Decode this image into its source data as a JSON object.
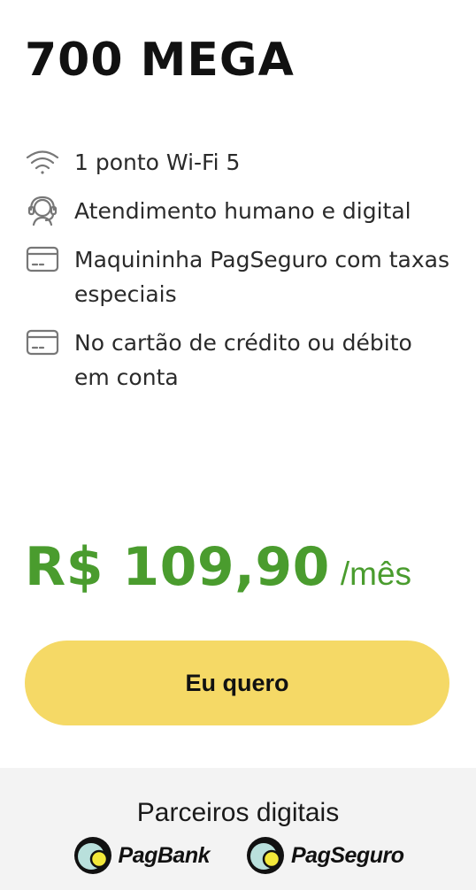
{
  "plan": {
    "title": "700 MEGA"
  },
  "features": [
    {
      "icon": "wifi-icon",
      "text": "1 ponto Wi-Fi 5"
    },
    {
      "icon": "headset-icon",
      "text": "Atendimento humano e digital"
    },
    {
      "icon": "card-terminal-icon",
      "text": "Maquininha PagSeguro com taxas especiais"
    },
    {
      "icon": "credit-card-icon",
      "text": "No cartão de crédito ou débito em conta"
    }
  ],
  "pricing": {
    "price": "R$ 109,90",
    "period": "/mês",
    "color": "#4a9c2e"
  },
  "cta": {
    "label": "Eu quero",
    "color": "#f5d966"
  },
  "partners": {
    "title": "Parceiros digitais",
    "logos": [
      {
        "name": "PagBank",
        "icon": "pagbank-logo-icon"
      },
      {
        "name": "PagSeguro",
        "icon": "pagseguro-logo-icon"
      }
    ]
  }
}
